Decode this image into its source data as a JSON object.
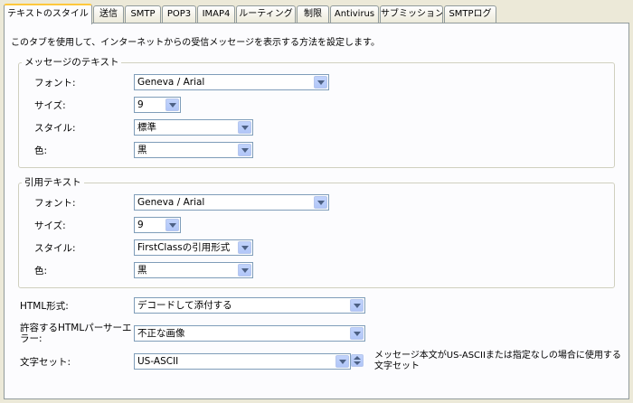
{
  "tabs": [
    {
      "label": "テキストのスタイル",
      "active": true
    },
    {
      "label": "送信"
    },
    {
      "label": "SMTP"
    },
    {
      "label": "POP3"
    },
    {
      "label": "IMAP4"
    },
    {
      "label": "ルーティング"
    },
    {
      "label": "制限"
    },
    {
      "label": "Antivirus"
    },
    {
      "label": "サブミッション"
    },
    {
      "label": "SMTPログ"
    }
  ],
  "description": "このタブを使用して、インターネットからの受信メッセージを表示する方法を設定します。",
  "message_text": {
    "legend": "メッセージのテキスト",
    "font_label": "フォント:",
    "font_value": "Geneva / Arial",
    "size_label": "サイズ:",
    "size_value": "9",
    "style_label": "スタイル:",
    "style_value": "標準",
    "color_label": "色:",
    "color_value": "黒"
  },
  "quoted_text": {
    "legend": "引用テキスト",
    "font_label": "フォント:",
    "font_value": "Geneva / Arial",
    "size_label": "サイズ:",
    "size_value": "9",
    "style_label": "スタイル:",
    "style_value": "FirstClassの引用形式",
    "color_label": "色:",
    "color_value": "黒"
  },
  "html_format": {
    "label": "HTML形式:",
    "value": "デコードして添付する"
  },
  "html_parser": {
    "label_line1": "許容するHTMLパーサーエ",
    "label_line2": "ラー:",
    "value": "不正な画像"
  },
  "charset": {
    "label": "文字セット:",
    "value": "US-ASCII",
    "note_line1": "メッセージ本文がUS-ASCIIまたは指定なしの場合に使用する",
    "note_line2": "文字セット"
  }
}
